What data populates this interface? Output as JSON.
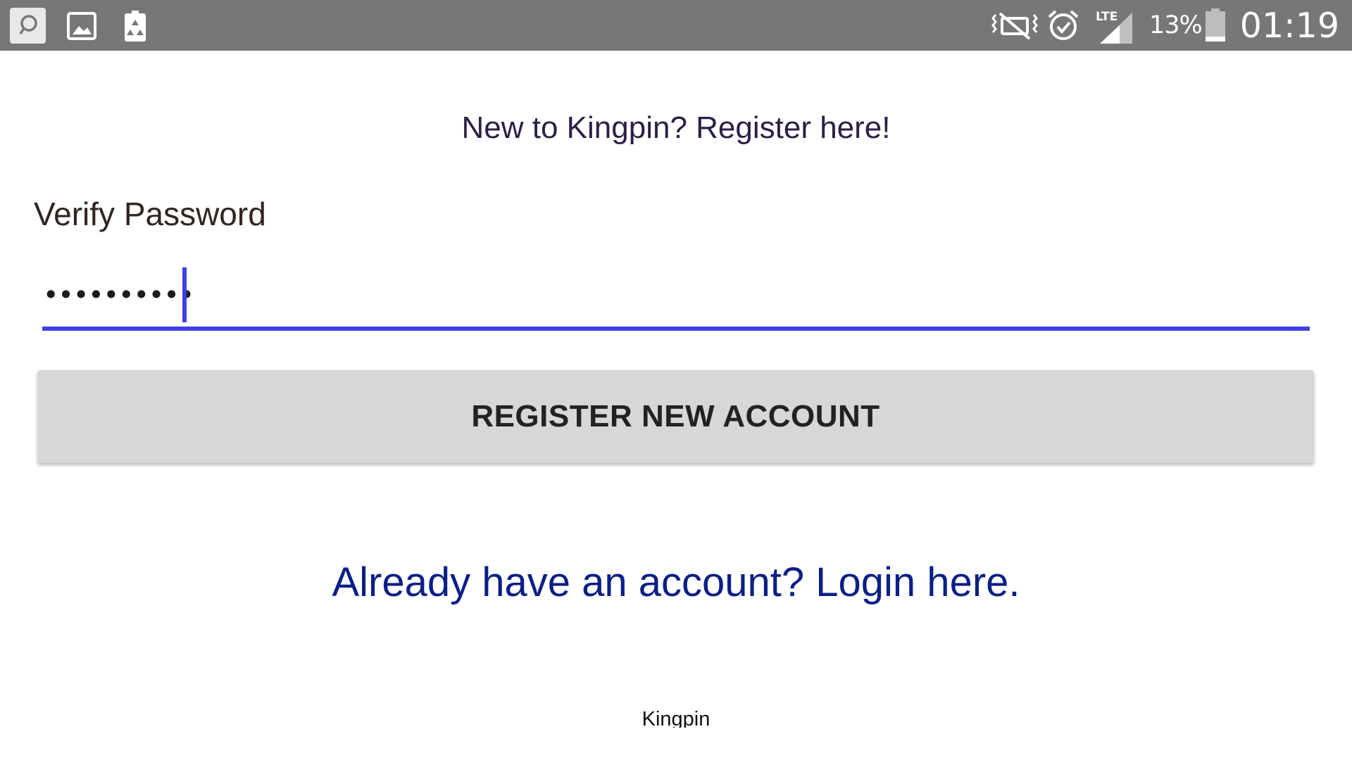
{
  "status_bar": {
    "left_icons": [
      "chat-bubble-icon",
      "image-icon",
      "recycle-battery-icon"
    ],
    "right_icons": [
      "vibrate-mute-icon",
      "alarm-clock-icon",
      "lte-signal-icon"
    ],
    "network_label": "LTE",
    "battery_percent": "13%",
    "time": "01:19",
    "background_color": "#777777"
  },
  "form": {
    "heading": "New to Kingpin? Register here!",
    "verify_password_label": "Verify Password",
    "password_masked": "••••••••••",
    "accent_color": "#4040e8",
    "register_button_label": "REGISTER NEW ACCOUNT"
  },
  "login_link": "Already have an account? Login here.",
  "footer": {
    "app_name": "Kingpin"
  }
}
